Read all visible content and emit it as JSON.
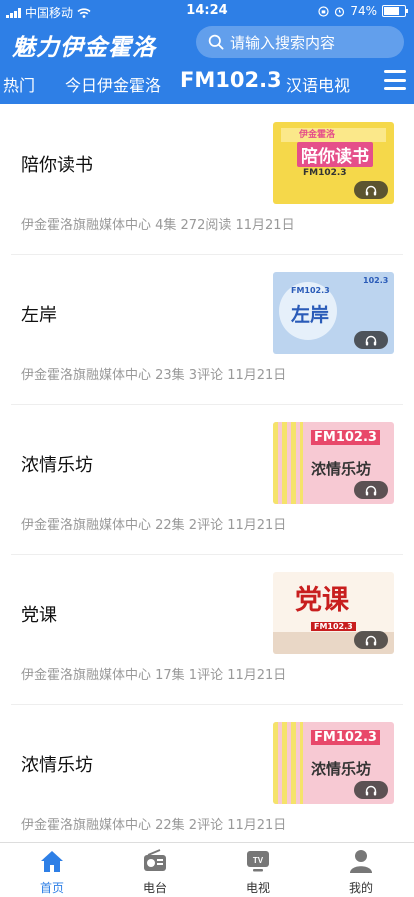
{
  "status_bar": {
    "carrier": "中国移动",
    "time": "14:24",
    "battery": "74%",
    "battery_level": 0.74
  },
  "header": {
    "logo": "魅力伊金霍洛",
    "search_placeholder": "请输入搜索内容"
  },
  "tabs": [
    {
      "label": "热门"
    },
    {
      "label": "今日伊金霍洛"
    },
    {
      "label": "FM102.3"
    },
    {
      "label": "汉语电视"
    }
  ],
  "active_tab": "FM102.3",
  "items": [
    {
      "title": "陪你读书",
      "meta": "伊金霍洛旗融媒体中心 4集 272阅读 11月21日",
      "thumb": {
        "bg": "#f5d84a",
        "accent": "#e54f8a",
        "text": "陪你读书",
        "sub": "FM102.3",
        "top_text": "伊金霍洛"
      }
    },
    {
      "title": "左岸",
      "meta": "伊金霍洛旗融媒体中心 23集 3评论 11月21日",
      "thumb": {
        "bg": "#bcd4ef",
        "accent": "#2a5bb8",
        "text": "左岸",
        "sub": "FM102.3",
        "top_text": "102.3"
      }
    },
    {
      "title": "浓情乐坊",
      "meta": "伊金霍洛旗融媒体中心 22集 2评论 11月21日",
      "thumb": {
        "bg": "#f7c9d3",
        "accent": "#e8486a",
        "text": "浓情乐坊",
        "sub": "FM102.3",
        "top_text": ""
      }
    },
    {
      "title": "党课",
      "meta": "伊金霍洛旗融媒体中心 17集 1评论 11月21日",
      "thumb": {
        "bg": "#fbf3ea",
        "accent": "#c81e1e",
        "text": "党课",
        "sub": "FM102.3",
        "top_text": ""
      }
    },
    {
      "title": "浓情乐坊",
      "meta": "伊金霍洛旗融媒体中心 22集 2评论 11月21日",
      "thumb": {
        "bg": "#f7c9d3",
        "accent": "#e8486a",
        "text": "浓情乐坊",
        "sub": "FM102.3",
        "top_text": ""
      }
    }
  ],
  "bottom_nav": [
    {
      "label": "首页",
      "icon": "home-icon"
    },
    {
      "label": "电台",
      "icon": "radio-icon"
    },
    {
      "label": "电视",
      "icon": "tv-icon"
    },
    {
      "label": "我的",
      "icon": "user-icon"
    }
  ],
  "colors": {
    "primary": "#2e7fe6",
    "meta_text": "#999999"
  }
}
